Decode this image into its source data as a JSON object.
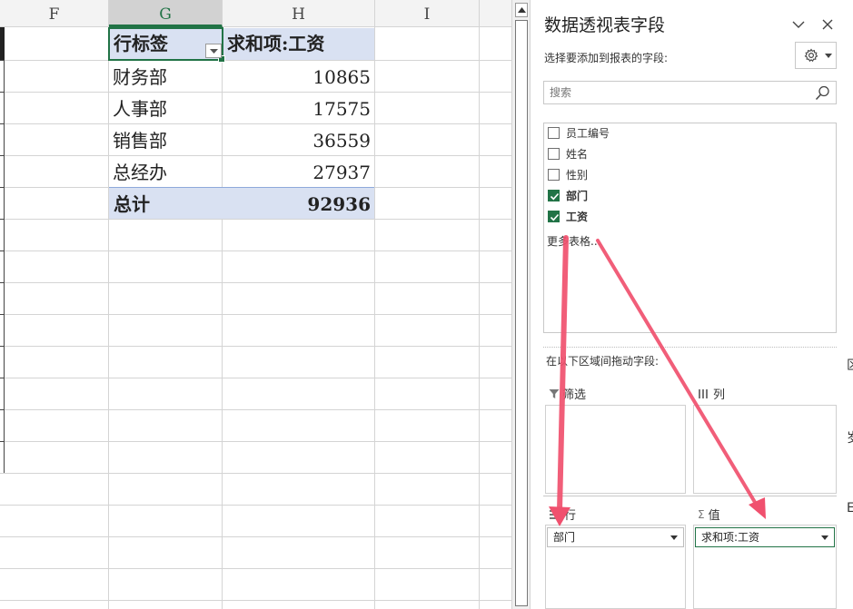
{
  "sheet": {
    "columns": [
      {
        "id": "F",
        "label": "F",
        "selected": false
      },
      {
        "id": "G",
        "label": "G",
        "selected": true
      },
      {
        "id": "H",
        "label": "H",
        "selected": false
      },
      {
        "id": "I",
        "label": "I",
        "selected": false
      }
    ],
    "pivot": {
      "row_label_header": "行标签",
      "value_header": "求和项:工资",
      "rows": [
        {
          "label": "财务部",
          "value": "10865"
        },
        {
          "label": "人事部",
          "value": "17575"
        },
        {
          "label": "销售部",
          "value": "36559"
        },
        {
          "label": "总经办",
          "value": "27937"
        }
      ],
      "total_label": "总计",
      "total_value": "92936"
    }
  },
  "pane": {
    "title": "数据透视表字段",
    "subtitle": "选择要添加到报表的字段:",
    "search_placeholder": "搜索",
    "fields": [
      {
        "label": "员工编号",
        "checked": false
      },
      {
        "label": "姓名",
        "checked": false
      },
      {
        "label": "性别",
        "checked": false
      },
      {
        "label": "部门",
        "checked": true
      },
      {
        "label": "工资",
        "checked": true
      }
    ],
    "more_tables": "更多表格...",
    "drag_hint": "在以下区域间拖动字段:",
    "areas": {
      "filter_label": "筛选",
      "columns_label": "列",
      "rows_label": "行",
      "values_label": "值",
      "values_symbol": "Σ",
      "rows_chip": "部门",
      "values_chip": "求和项:工资"
    }
  },
  "colors": {
    "accent": "#217346",
    "pivot_band": "#d9e1f2",
    "arrow": "#f0506e"
  },
  "icons": {
    "close": "close-icon",
    "collapse": "chevron-down-icon",
    "gear": "gear-icon",
    "search": "search-icon",
    "filter": "filter-icon",
    "columns": "columns-icon",
    "rows": "rows-icon",
    "sum": "sigma-icon"
  }
}
